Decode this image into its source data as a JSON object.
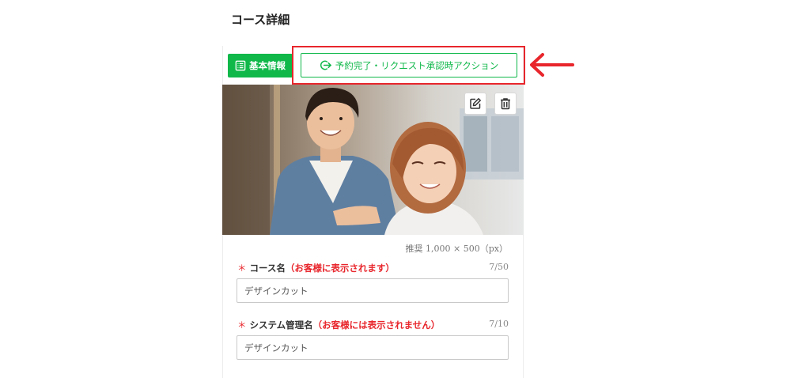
{
  "page": {
    "title": "コース詳細"
  },
  "tabs": {
    "basic": {
      "label": "基本情報",
      "icon": "list-icon"
    },
    "action": {
      "label": "予約完了・リクエスト承認時アクション",
      "icon": "logout-arrow-icon"
    }
  },
  "photo": {
    "edit_icon": "edit-icon",
    "delete_icon": "trash-icon",
    "recommend_size": "推奨 1,000 × 500（px）"
  },
  "course_name": {
    "required_mark": "＊",
    "label": "コース名",
    "note": "（お客様に表示されます）",
    "counter": "7/50",
    "value": "デザインカット"
  },
  "system_name": {
    "required_mark": "＊",
    "label": "システム管理名",
    "note": "（お客様には表示されません）",
    "counter": "7/10",
    "value": "デザインカット"
  },
  "colors": {
    "accent_green": "#10b84a",
    "highlight_red": "#e8262c"
  }
}
